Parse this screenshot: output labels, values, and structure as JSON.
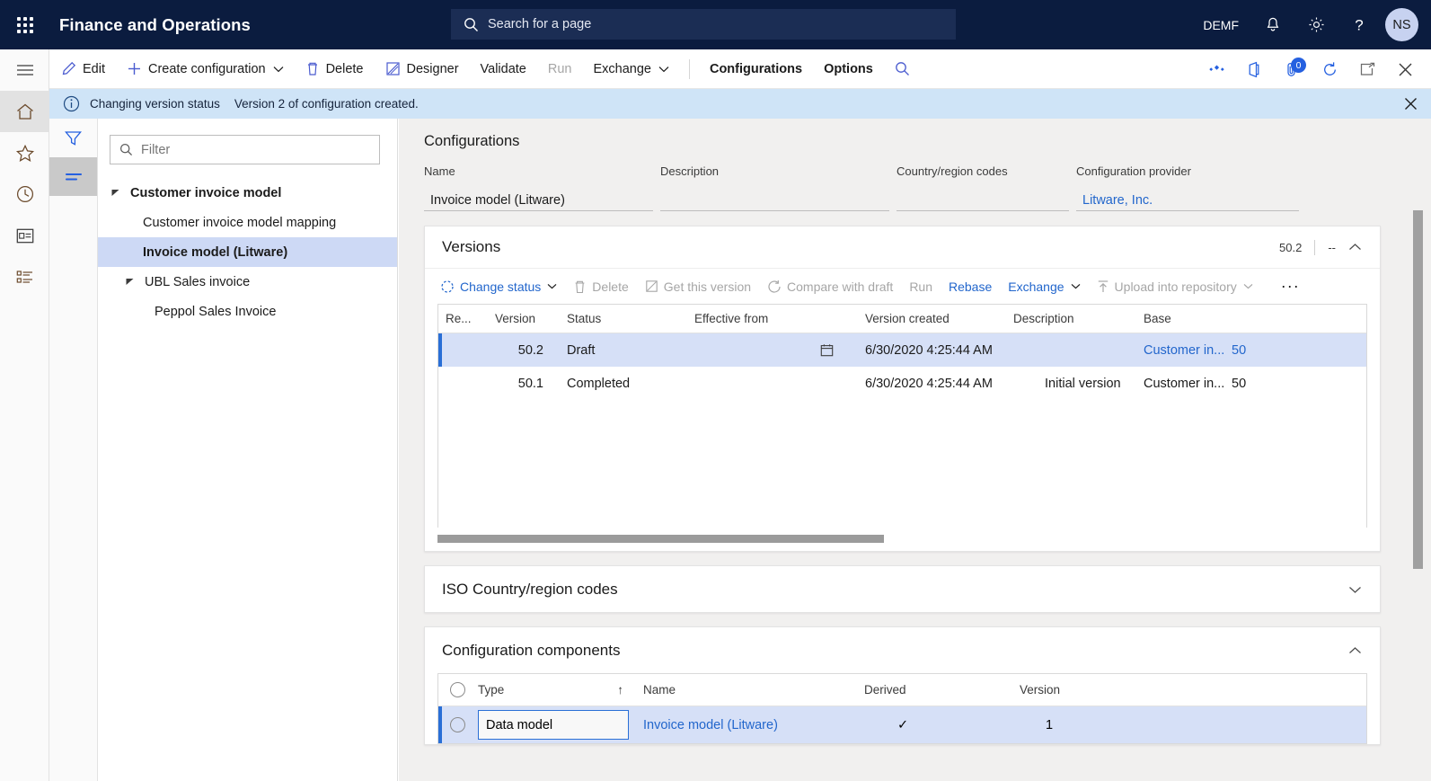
{
  "topbar": {
    "waffle_label": "app-launcher",
    "app_title": "Finance and Operations",
    "search_placeholder": "Search for a page",
    "company": "DEMF",
    "notifications_label": "notifications",
    "settings_label": "settings",
    "help_label": "help",
    "avatar_initials": "NS"
  },
  "toolbar": {
    "edit": "Edit",
    "create_configuration": "Create configuration",
    "delete": "Delete",
    "designer": "Designer",
    "validate": "Validate",
    "run": "Run",
    "exchange": "Exchange",
    "configurations": "Configurations",
    "options": "Options",
    "search_label": "search",
    "personalize_label": "personalize",
    "office_label": "open-in-office",
    "attachments_badge": "0",
    "refresh_label": "refresh",
    "popout_label": "open-in-new-window",
    "close_label": "close"
  },
  "message_bar": {
    "title": "Changing version status",
    "text": "Version 2 of configuration created.",
    "close_label": "close-message"
  },
  "rail": {
    "hamburger": "navigation-menu",
    "items": [
      {
        "name": "home",
        "label": "Home"
      },
      {
        "name": "favorites",
        "label": "Favorites"
      },
      {
        "name": "recent",
        "label": "Recent"
      },
      {
        "name": "workspaces",
        "label": "Workspaces"
      },
      {
        "name": "modules",
        "label": "Modules"
      }
    ]
  },
  "filter_rail": {
    "filter": "Filter",
    "list": "List"
  },
  "tree": {
    "filter_placeholder": "Filter",
    "nodes": [
      {
        "label": "Customer invoice model",
        "level": 1,
        "expanded": true,
        "selected": false
      },
      {
        "label": "Customer invoice model mapping",
        "level": 2,
        "expanded": false,
        "selected": false
      },
      {
        "label": "Invoice model (Litware)",
        "level": 2,
        "expanded": false,
        "selected": true
      },
      {
        "label": "UBL Sales invoice",
        "level": 1,
        "expanded": true,
        "selected": false
      },
      {
        "label": "Peppol Sales Invoice",
        "level": 2,
        "expanded": false,
        "selected": false
      }
    ]
  },
  "configurations": {
    "heading": "Configurations",
    "fields": [
      {
        "label": "Name",
        "value": "Invoice model (Litware)",
        "link": false
      },
      {
        "label": "Description",
        "value": "",
        "link": false
      },
      {
        "label": "Country/region codes",
        "value": "",
        "link": false
      },
      {
        "label": "Configuration provider",
        "value": "Litware, Inc.",
        "link": true
      }
    ]
  },
  "versions": {
    "title": "Versions",
    "summary_version": "50.2",
    "summary_dash": "--",
    "collapse_label": "collapse",
    "toolbar": {
      "change_status": "Change status",
      "delete": "Delete",
      "get_this_version": "Get this version",
      "compare_with_draft": "Compare with draft",
      "run": "Run",
      "rebase": "Rebase",
      "exchange": "Exchange",
      "upload_into_repository": "Upload into repository",
      "more": "···"
    },
    "columns": [
      "Re...",
      "Version",
      "Status",
      "Effective from",
      "Version created",
      "Description",
      "Base",
      ""
    ],
    "rows": [
      {
        "re": "",
        "version": "50.2",
        "status": "Draft",
        "effective_from": "",
        "version_created": "6/30/2020 4:25:44 AM",
        "description": "",
        "base": "Customer in...",
        "base_num": "50",
        "selected": true,
        "has_calendar_icon": true
      },
      {
        "re": "",
        "version": "50.1",
        "status": "Completed",
        "effective_from": "",
        "version_created": "6/30/2020 4:25:44 AM",
        "description": "Initial version",
        "base": "Customer in...",
        "base_num": "50",
        "selected": false,
        "has_calendar_icon": false
      }
    ]
  },
  "iso_section": {
    "title": "ISO Country/region codes",
    "expand_label": "expand"
  },
  "components_section": {
    "title": "Configuration components",
    "collapse_label": "collapse",
    "columns": [
      "Type",
      "Name",
      "Derived",
      "Version"
    ],
    "sort_indicator": "↑",
    "rows": [
      {
        "type": "Data model",
        "name": "Invoice model (Litware)",
        "derived": "✓",
        "version": "1",
        "selected": true,
        "editing": true
      }
    ]
  },
  "colors": {
    "nav_bg": "#0b1c3f",
    "accent_blue": "#2266cc",
    "selection_blue": "#d6e0f7",
    "message_bar_bg": "#cfe4f7",
    "page_bg": "#f1f0ef"
  }
}
